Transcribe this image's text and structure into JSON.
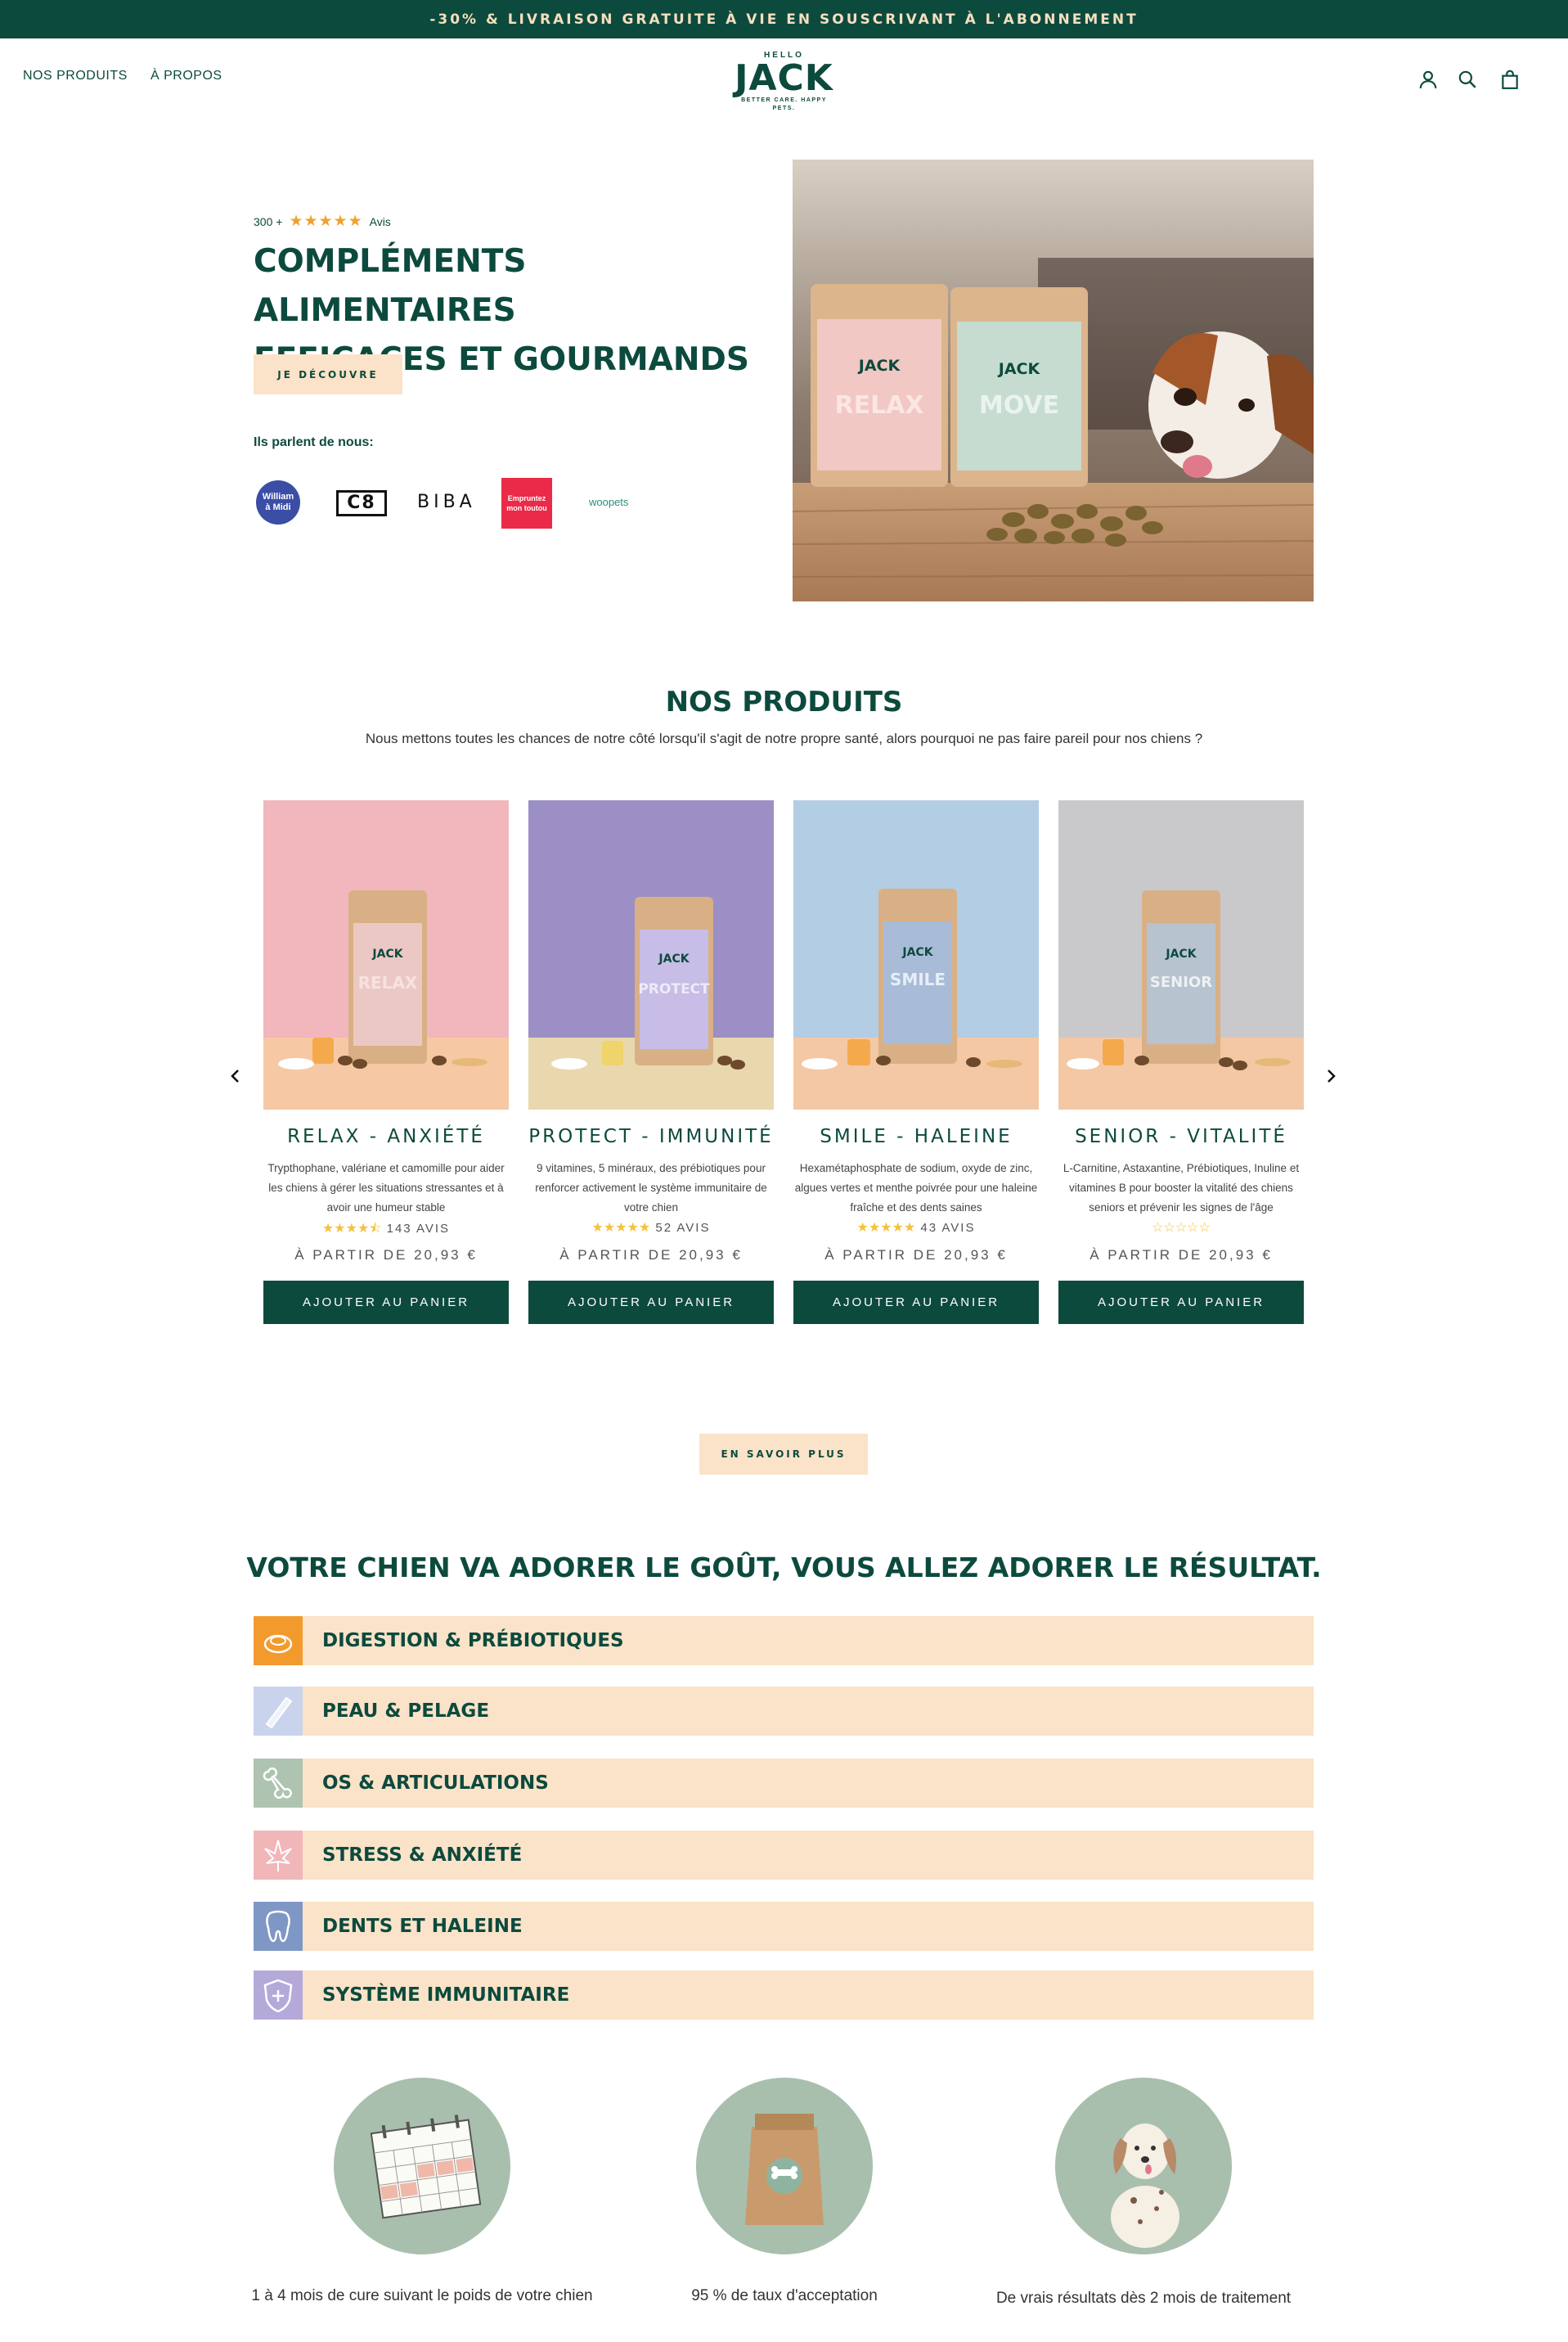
{
  "announcement": "-30% & LIVRAISON GRATUITE À VIE EN SOUSCRIVANT À L'ABONNEMENT",
  "nav": {
    "products": "NOS PRODUITS",
    "about": "À PROPOS"
  },
  "logo": {
    "hello": "HELLO",
    "name": "JACK",
    "tagline": "BETTER CARE. HAPPY PETS."
  },
  "header_icons": [
    "account-icon",
    "search-icon",
    "cart-icon"
  ],
  "hero": {
    "rating_count": "300 +",
    "stars": "★★★★★",
    "rating_label": "Avis",
    "title_line1": "COMPLÉMENTS ALIMENTAIRES",
    "title_line2": "EFFICACES ET GOURMANDS",
    "cta": "JE DÉCOUVRE",
    "press_title": "Ils parlent de nous:",
    "press": {
      "wm_line1": "William",
      "wm_line2": "à Midi",
      "c8": "C8",
      "biba": "BIBA",
      "eg_line1": "Empruntez",
      "eg_line2": "mon toutou",
      "woopets": "woopets"
    },
    "pack_brand": "JACK",
    "pack1": "RELAX",
    "pack2": "MOVE"
  },
  "products_section": {
    "title": "NOS PRODUITS",
    "subtitle": "Nous mettons toutes les chances de notre côté lorsqu'il s'agit de notre propre santé, alors pourquoi ne pas faire pareil pour nos chiens ?",
    "items": [
      {
        "name": "RELAX - ANXIÉTÉ",
        "pack": "RELAX",
        "desc": "Trypthophane, valériane et camomille pour aider les chiens à gérer les situations stressantes et à avoir une humeur stable",
        "stars": "★★★★⯪",
        "reviews": "143 AVIS",
        "price": "À PARTIR DE 20,93 €",
        "button": "AJOUTER AU PANIER"
      },
      {
        "name": "PROTECT - IMMUNITÉ",
        "pack": "PROTECT",
        "desc": "9 vitamines, 5 minéraux, des prébiotiques pour renforcer activement le système immunitaire de votre chien",
        "stars": "★★★★★",
        "reviews": "52 AVIS",
        "price": "À PARTIR DE 20,93 €",
        "button": "AJOUTER AU PANIER"
      },
      {
        "name": "SMILE - HALEINE",
        "pack": "SMILE",
        "desc": "Hexamétaphosphate de sodium, oxyde de zinc, algues vertes et menthe poivrée pour une haleine fraîche et des dents saines",
        "stars": "★★★★★",
        "reviews": "43 AVIS",
        "price": "À PARTIR DE 20,93 €",
        "button": "AJOUTER AU PANIER"
      },
      {
        "name": "SENIOR - VITALITÉ",
        "pack": "SENIOR",
        "desc": "L-Carnitine, Astaxantine, Prébiotiques, Inuline et vitamines B pour booster la vitalité des chiens seniors et prévenir les signes de l'âge",
        "stars": "☆☆☆☆☆",
        "reviews": "",
        "price": "À PARTIR DE 20,93 €",
        "button": "AJOUTER AU PANIER"
      }
    ],
    "more": "EN SAVOIR PLUS"
  },
  "benefits": {
    "title": "VOTRE CHIEN VA ADORER LE GOÛT, VOUS ALLEZ ADORER LE RÉSULTAT.",
    "items": [
      {
        "label": "DIGESTION & PRÉBIOTIQUES",
        "icon": "digestion-icon",
        "color": "#f39a2d"
      },
      {
        "label": "PEAU & PELAGE",
        "icon": "skin-icon",
        "color": "#c9d4ec"
      },
      {
        "label": "OS & ARTICULATIONS",
        "icon": "bone-icon",
        "color": "#aec4b1"
      },
      {
        "label": "STRESS & ANXIÉTÉ",
        "icon": "leaf-icon",
        "color": "#f1b6b8"
      },
      {
        "label": "DENTS ET HALEINE",
        "icon": "tooth-icon",
        "color": "#7f97c4"
      },
      {
        "label": "SYSTÈME IMMUNITAIRE",
        "icon": "shield-icon",
        "color": "#b5a9da"
      }
    ]
  },
  "stats": [
    {
      "text": "1 à 4 mois de cure suivant le poids de votre chien",
      "icon": "calendar-icon"
    },
    {
      "text": "95 % de taux d'acceptation",
      "icon": "bag-icon"
    },
    {
      "text": "De vrais résultats dès 2 mois de traitement",
      "icon": "dog-icon"
    }
  ],
  "colors": {
    "primary": "#0d4a3e",
    "peach": "#fae3c8",
    "star": "#f0a22e"
  }
}
